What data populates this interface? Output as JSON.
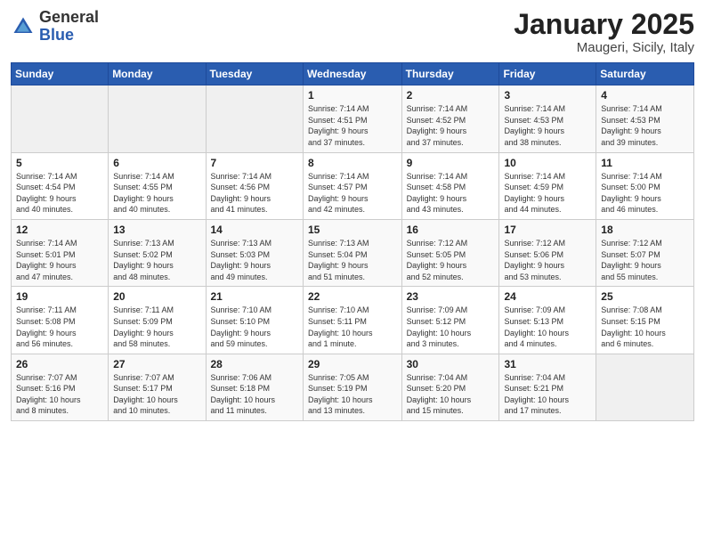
{
  "logo": {
    "general": "General",
    "blue": "Blue"
  },
  "header": {
    "title": "January 2025",
    "subtitle": "Maugeri, Sicily, Italy"
  },
  "weekdays": [
    "Sunday",
    "Monday",
    "Tuesday",
    "Wednesday",
    "Thursday",
    "Friday",
    "Saturday"
  ],
  "weeks": [
    [
      {
        "day": "",
        "info": ""
      },
      {
        "day": "",
        "info": ""
      },
      {
        "day": "",
        "info": ""
      },
      {
        "day": "1",
        "info": "Sunrise: 7:14 AM\nSunset: 4:51 PM\nDaylight: 9 hours\nand 37 minutes."
      },
      {
        "day": "2",
        "info": "Sunrise: 7:14 AM\nSunset: 4:52 PM\nDaylight: 9 hours\nand 37 minutes."
      },
      {
        "day": "3",
        "info": "Sunrise: 7:14 AM\nSunset: 4:53 PM\nDaylight: 9 hours\nand 38 minutes."
      },
      {
        "day": "4",
        "info": "Sunrise: 7:14 AM\nSunset: 4:53 PM\nDaylight: 9 hours\nand 39 minutes."
      }
    ],
    [
      {
        "day": "5",
        "info": "Sunrise: 7:14 AM\nSunset: 4:54 PM\nDaylight: 9 hours\nand 40 minutes."
      },
      {
        "day": "6",
        "info": "Sunrise: 7:14 AM\nSunset: 4:55 PM\nDaylight: 9 hours\nand 40 minutes."
      },
      {
        "day": "7",
        "info": "Sunrise: 7:14 AM\nSunset: 4:56 PM\nDaylight: 9 hours\nand 41 minutes."
      },
      {
        "day": "8",
        "info": "Sunrise: 7:14 AM\nSunset: 4:57 PM\nDaylight: 9 hours\nand 42 minutes."
      },
      {
        "day": "9",
        "info": "Sunrise: 7:14 AM\nSunset: 4:58 PM\nDaylight: 9 hours\nand 43 minutes."
      },
      {
        "day": "10",
        "info": "Sunrise: 7:14 AM\nSunset: 4:59 PM\nDaylight: 9 hours\nand 44 minutes."
      },
      {
        "day": "11",
        "info": "Sunrise: 7:14 AM\nSunset: 5:00 PM\nDaylight: 9 hours\nand 46 minutes."
      }
    ],
    [
      {
        "day": "12",
        "info": "Sunrise: 7:14 AM\nSunset: 5:01 PM\nDaylight: 9 hours\nand 47 minutes."
      },
      {
        "day": "13",
        "info": "Sunrise: 7:13 AM\nSunset: 5:02 PM\nDaylight: 9 hours\nand 48 minutes."
      },
      {
        "day": "14",
        "info": "Sunrise: 7:13 AM\nSunset: 5:03 PM\nDaylight: 9 hours\nand 49 minutes."
      },
      {
        "day": "15",
        "info": "Sunrise: 7:13 AM\nSunset: 5:04 PM\nDaylight: 9 hours\nand 51 minutes."
      },
      {
        "day": "16",
        "info": "Sunrise: 7:12 AM\nSunset: 5:05 PM\nDaylight: 9 hours\nand 52 minutes."
      },
      {
        "day": "17",
        "info": "Sunrise: 7:12 AM\nSunset: 5:06 PM\nDaylight: 9 hours\nand 53 minutes."
      },
      {
        "day": "18",
        "info": "Sunrise: 7:12 AM\nSunset: 5:07 PM\nDaylight: 9 hours\nand 55 minutes."
      }
    ],
    [
      {
        "day": "19",
        "info": "Sunrise: 7:11 AM\nSunset: 5:08 PM\nDaylight: 9 hours\nand 56 minutes."
      },
      {
        "day": "20",
        "info": "Sunrise: 7:11 AM\nSunset: 5:09 PM\nDaylight: 9 hours\nand 58 minutes."
      },
      {
        "day": "21",
        "info": "Sunrise: 7:10 AM\nSunset: 5:10 PM\nDaylight: 9 hours\nand 59 minutes."
      },
      {
        "day": "22",
        "info": "Sunrise: 7:10 AM\nSunset: 5:11 PM\nDaylight: 10 hours\nand 1 minute."
      },
      {
        "day": "23",
        "info": "Sunrise: 7:09 AM\nSunset: 5:12 PM\nDaylight: 10 hours\nand 3 minutes."
      },
      {
        "day": "24",
        "info": "Sunrise: 7:09 AM\nSunset: 5:13 PM\nDaylight: 10 hours\nand 4 minutes."
      },
      {
        "day": "25",
        "info": "Sunrise: 7:08 AM\nSunset: 5:15 PM\nDaylight: 10 hours\nand 6 minutes."
      }
    ],
    [
      {
        "day": "26",
        "info": "Sunrise: 7:07 AM\nSunset: 5:16 PM\nDaylight: 10 hours\nand 8 minutes."
      },
      {
        "day": "27",
        "info": "Sunrise: 7:07 AM\nSunset: 5:17 PM\nDaylight: 10 hours\nand 10 minutes."
      },
      {
        "day": "28",
        "info": "Sunrise: 7:06 AM\nSunset: 5:18 PM\nDaylight: 10 hours\nand 11 minutes."
      },
      {
        "day": "29",
        "info": "Sunrise: 7:05 AM\nSunset: 5:19 PM\nDaylight: 10 hours\nand 13 minutes."
      },
      {
        "day": "30",
        "info": "Sunrise: 7:04 AM\nSunset: 5:20 PM\nDaylight: 10 hours\nand 15 minutes."
      },
      {
        "day": "31",
        "info": "Sunrise: 7:04 AM\nSunset: 5:21 PM\nDaylight: 10 hours\nand 17 minutes."
      },
      {
        "day": "",
        "info": ""
      }
    ]
  ]
}
